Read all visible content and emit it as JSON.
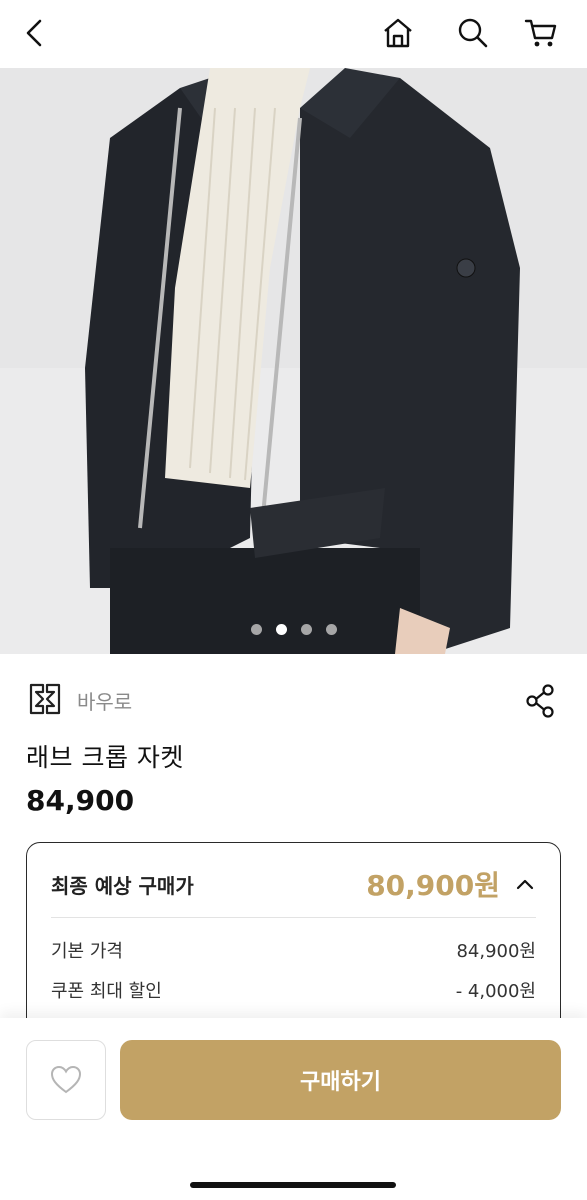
{
  "header": {
    "icons": [
      "chevron-left-icon",
      "home-icon",
      "search-icon",
      "cart-icon"
    ]
  },
  "gallery": {
    "page_count": 4,
    "active_index": 1
  },
  "brand": {
    "name": "바우로"
  },
  "product": {
    "name": "래브 크롭 자켓",
    "price": "84,900"
  },
  "price_summary": {
    "final_label": "최종 예상 구매가",
    "final_value": "80,900원",
    "rows": [
      {
        "label": "기본 가격",
        "value": "84,900원"
      },
      {
        "label": "쿠폰 최대 할인",
        "value": "- 4,000원"
      }
    ]
  },
  "actions": {
    "buy_label": "구매하기"
  },
  "colors": {
    "accent": "#c2a265",
    "text": "#111111",
    "muted": "#8a8a8a"
  }
}
